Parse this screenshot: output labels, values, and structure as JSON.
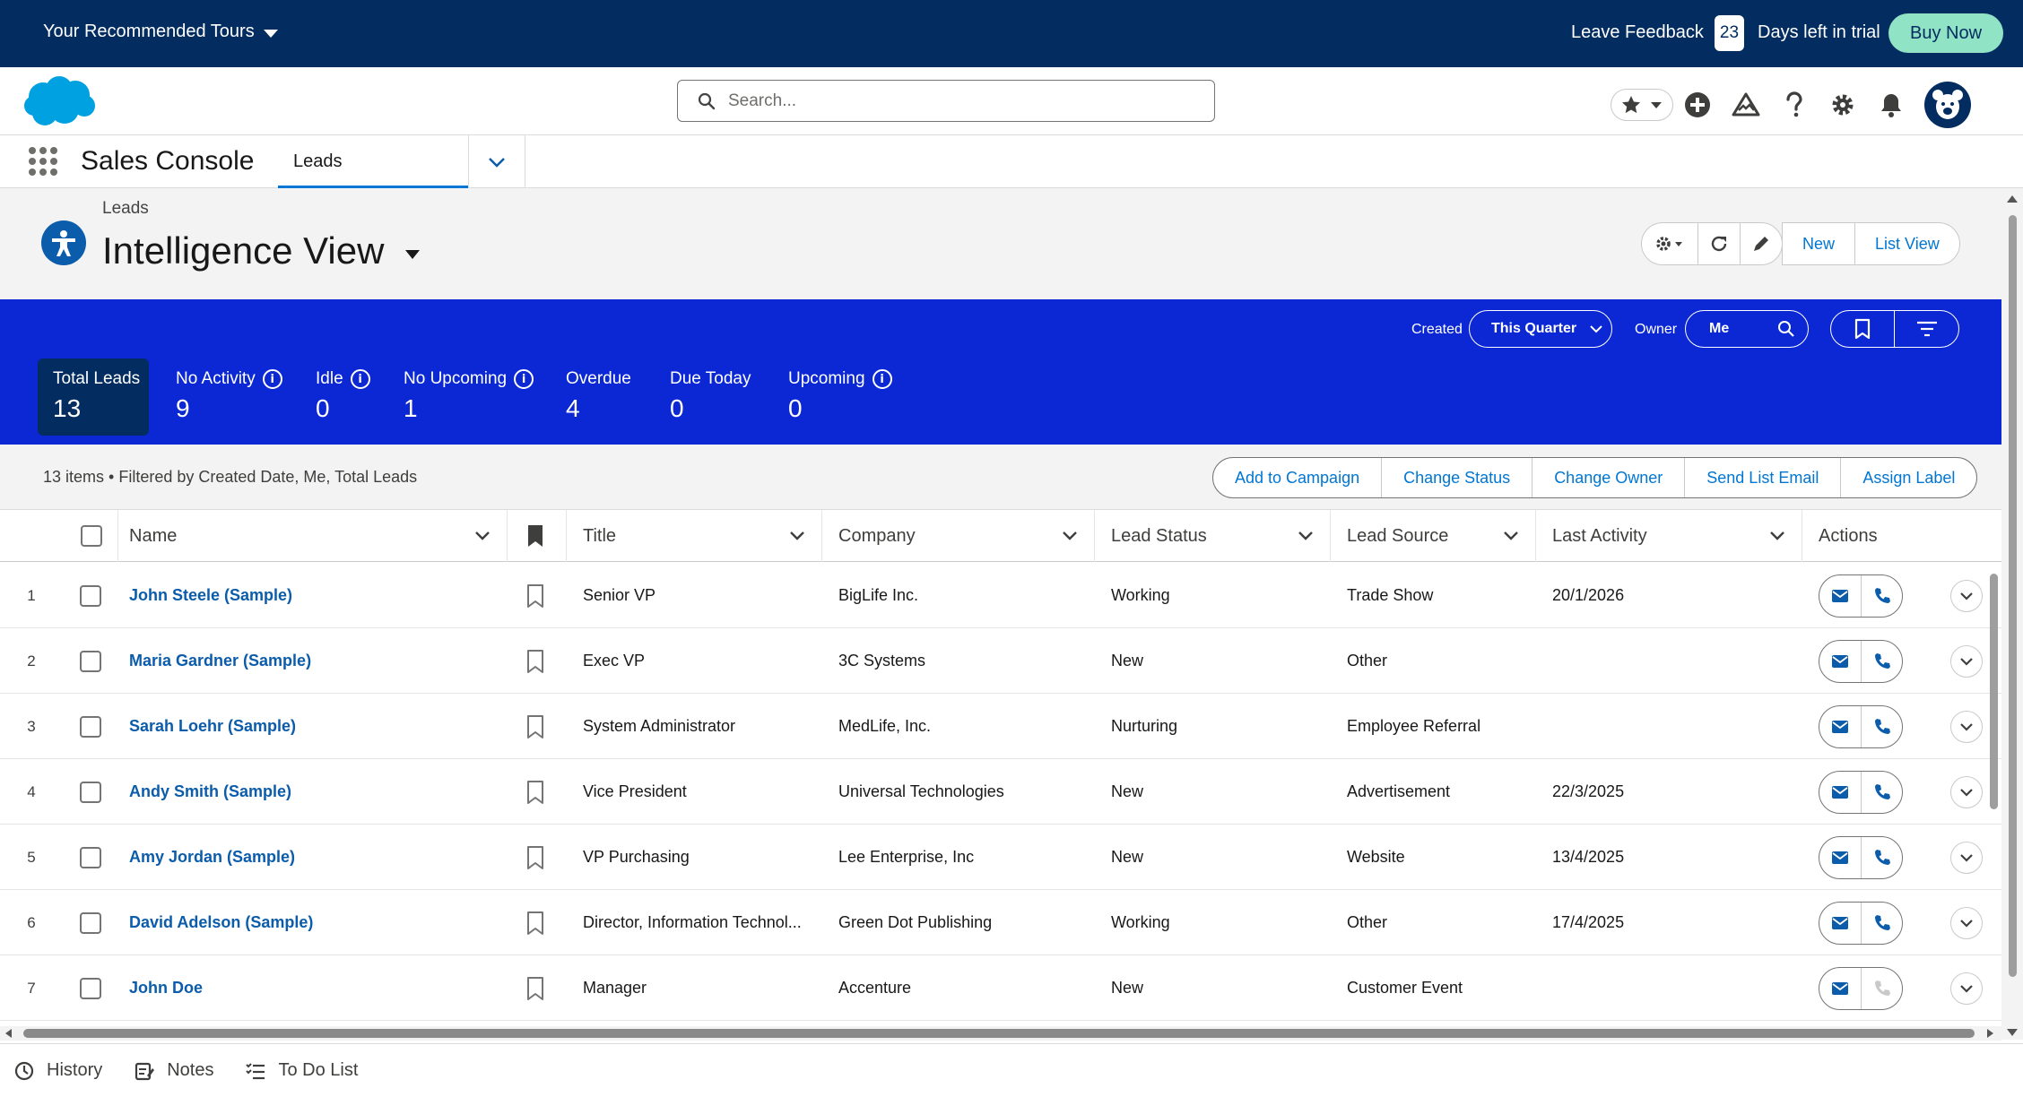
{
  "trial_bar": {
    "tours_label": "Your Recommended Tours",
    "feedback_label": "Leave Feedback",
    "days_left": "23",
    "days_text": "Days left in trial",
    "buy_label": "Buy Now"
  },
  "header": {
    "search_placeholder": "Search..."
  },
  "app_nav": {
    "app_name": "Sales Console",
    "tab_label": "Leads"
  },
  "page": {
    "breadcrumb": "Leads",
    "title": "Intelligence View",
    "new_label": "New",
    "list_view_label": "List View"
  },
  "filters": {
    "created_label": "Created",
    "created_value": "This Quarter",
    "owner_label": "Owner",
    "owner_value": "Me"
  },
  "metrics": [
    {
      "label": "Total Leads",
      "value": "13"
    },
    {
      "label": "No Activity",
      "value": "9"
    },
    {
      "label": "Idle",
      "value": "0"
    },
    {
      "label": "No Upcoming",
      "value": "1"
    },
    {
      "label": "Overdue",
      "value": "4"
    },
    {
      "label": "Due Today",
      "value": "0"
    },
    {
      "label": "Upcoming",
      "value": "0"
    }
  ],
  "list": {
    "info": "13 items • Filtered by Created Date, Me, Total Leads",
    "actions": [
      "Add to Campaign",
      "Change Status",
      "Change Owner",
      "Send List Email",
      "Assign Label"
    ]
  },
  "columns": {
    "name": "Name",
    "title": "Title",
    "company": "Company",
    "status": "Lead Status",
    "source": "Lead Source",
    "activity": "Last Activity",
    "actions": "Actions"
  },
  "rows": [
    {
      "num": "1",
      "name": "John Steele (Sample)",
      "title": "Senior VP",
      "company": "BigLife Inc.",
      "status": "Working",
      "source": "Trade Show",
      "activity": "20/1/2026"
    },
    {
      "num": "2",
      "name": "Maria Gardner (Sample)",
      "title": "Exec VP",
      "company": "3C Systems",
      "status": "New",
      "source": "Other",
      "activity": ""
    },
    {
      "num": "3",
      "name": "Sarah Loehr (Sample)",
      "title": "System Administrator",
      "company": "MedLife, Inc.",
      "status": "Nurturing",
      "source": "Employee Referral",
      "activity": ""
    },
    {
      "num": "4",
      "name": "Andy Smith (Sample)",
      "title": "Vice President",
      "company": "Universal Technologies",
      "status": "New",
      "source": "Advertisement",
      "activity": "22/3/2025"
    },
    {
      "num": "5",
      "name": "Amy Jordan (Sample)",
      "title": "VP Purchasing",
      "company": "Lee Enterprise, Inc",
      "status": "New",
      "source": "Website",
      "activity": "13/4/2025"
    },
    {
      "num": "6",
      "name": "David Adelson (Sample)",
      "title": "Director, Information Technol...",
      "company": "Green Dot Publishing",
      "status": "Working",
      "source": "Other",
      "activity": "17/4/2025"
    },
    {
      "num": "7",
      "name": "John Doe",
      "title": "Manager",
      "company": "Accenture",
      "status": "New",
      "source": "Customer Event",
      "activity": ""
    }
  ],
  "utility_bar": {
    "history": "History",
    "notes": "Notes",
    "todo": "To Do List"
  },
  "colors": {
    "trial_bar": "#032d60",
    "band": "#0b28d4",
    "accent": "#0176d3",
    "link": "#0b5cab",
    "buy": "#91e3c5"
  }
}
